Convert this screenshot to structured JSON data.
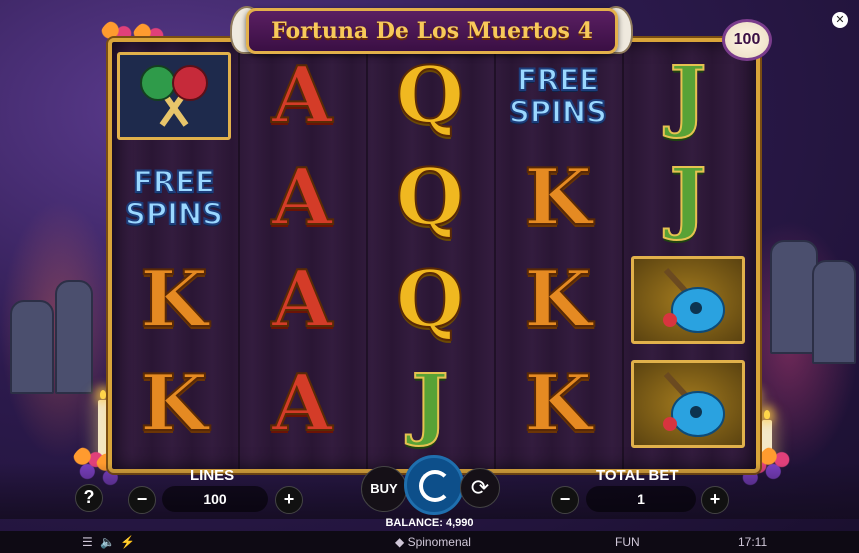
{
  "game": {
    "title": "Fortuna De Los Muertos 4",
    "top_win_badge": "100"
  },
  "reels": [
    [
      "maraca",
      "freespins",
      "K",
      "K"
    ],
    [
      "A",
      "A",
      "A",
      "A"
    ],
    [
      "Q",
      "Q",
      "Q",
      "J"
    ],
    [
      "freespins",
      "K",
      "K",
      "K"
    ],
    [
      "J",
      "J",
      "guitar",
      "guitar"
    ]
  ],
  "freespins_text": [
    "FREE",
    "SPINS"
  ],
  "controls": {
    "help_label": "?",
    "lines_label": "LINES",
    "lines_value": "100",
    "minus": "−",
    "plus": "+",
    "buy_label": "BUY",
    "total_bet_label": "TOTAL BET",
    "total_bet_value": "1",
    "balance_text": "BALANCE: 4,990"
  },
  "footer": {
    "menu_icon": "hamburger-icon",
    "sound_icon": "speaker-icon",
    "speed_icon": "turbo-icon",
    "provider": "Spinomenal",
    "mode": "FUN",
    "clock": "17:11"
  },
  "colors": {
    "frame_gold": "#d9a53a",
    "title_purple": "#5a1f62",
    "spin_blue": "#0d4f8a"
  }
}
